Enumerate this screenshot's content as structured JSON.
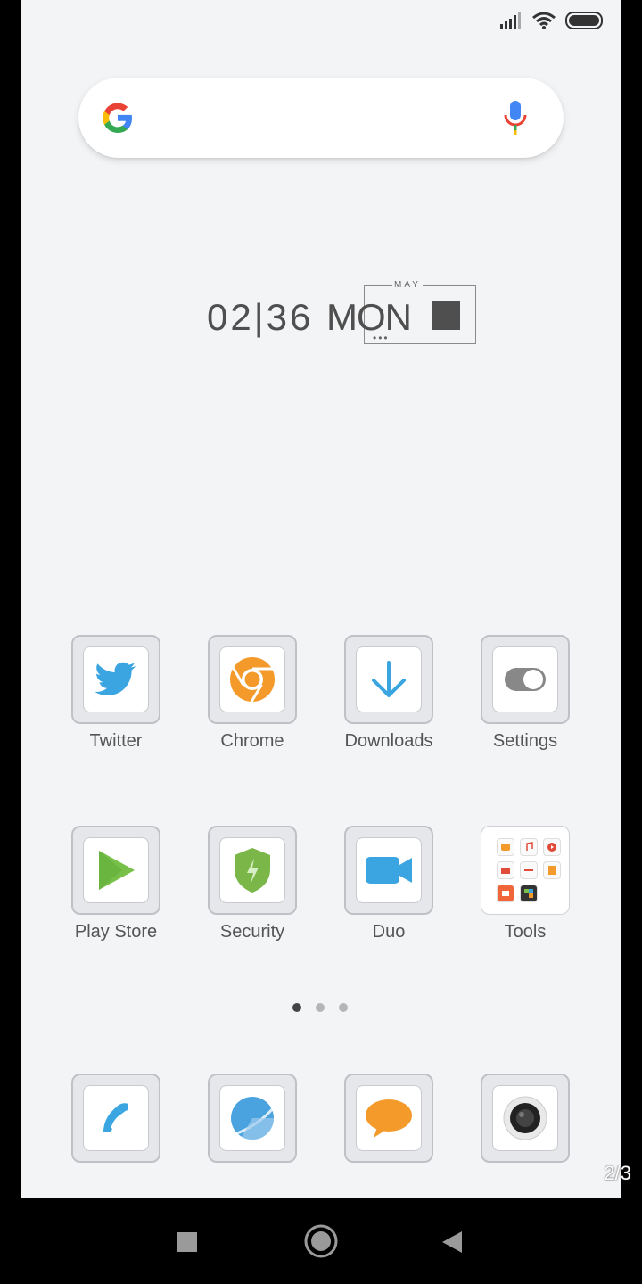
{
  "statusbar": {
    "icons": [
      "signal-icon",
      "wifi-icon",
      "battery-icon"
    ]
  },
  "search": {
    "logo": "google-logo-icon",
    "mic": "mic-icon"
  },
  "clock": {
    "time": "02|36",
    "weekday": "MON",
    "month": "MAY",
    "dots": "•••"
  },
  "apps": {
    "row1": [
      {
        "label": "Twitter",
        "icon": "twitter-icon"
      },
      {
        "label": "Chrome",
        "icon": "chrome-icon"
      },
      {
        "label": "Downloads",
        "icon": "download-icon"
      },
      {
        "label": "Settings",
        "icon": "toggle-icon"
      }
    ],
    "row2": [
      {
        "label": "Play Store",
        "icon": "play-store-icon"
      },
      {
        "label": "Security",
        "icon": "shield-icon"
      },
      {
        "label": "Duo",
        "icon": "video-camera-icon"
      },
      {
        "label": "Tools",
        "icon": "folder-icon"
      }
    ]
  },
  "dock": {
    "icons": [
      "phone-icon",
      "browser-icon",
      "messages-icon",
      "camera-icon"
    ]
  },
  "page": {
    "indicator": "2/3",
    "dots_count": 3,
    "active_dot": 1
  },
  "colors": {
    "background": "#f3f4f6",
    "twitter": "#3aa5e0",
    "chrome": "#f39a2b",
    "download": "#3aa5e0",
    "play": "#79c04a",
    "shield": "#7ab648",
    "duo": "#3aa5e0",
    "messages": "#f39a2b"
  },
  "navbar": {
    "buttons": [
      "recents-button",
      "home-button",
      "back-button"
    ]
  }
}
